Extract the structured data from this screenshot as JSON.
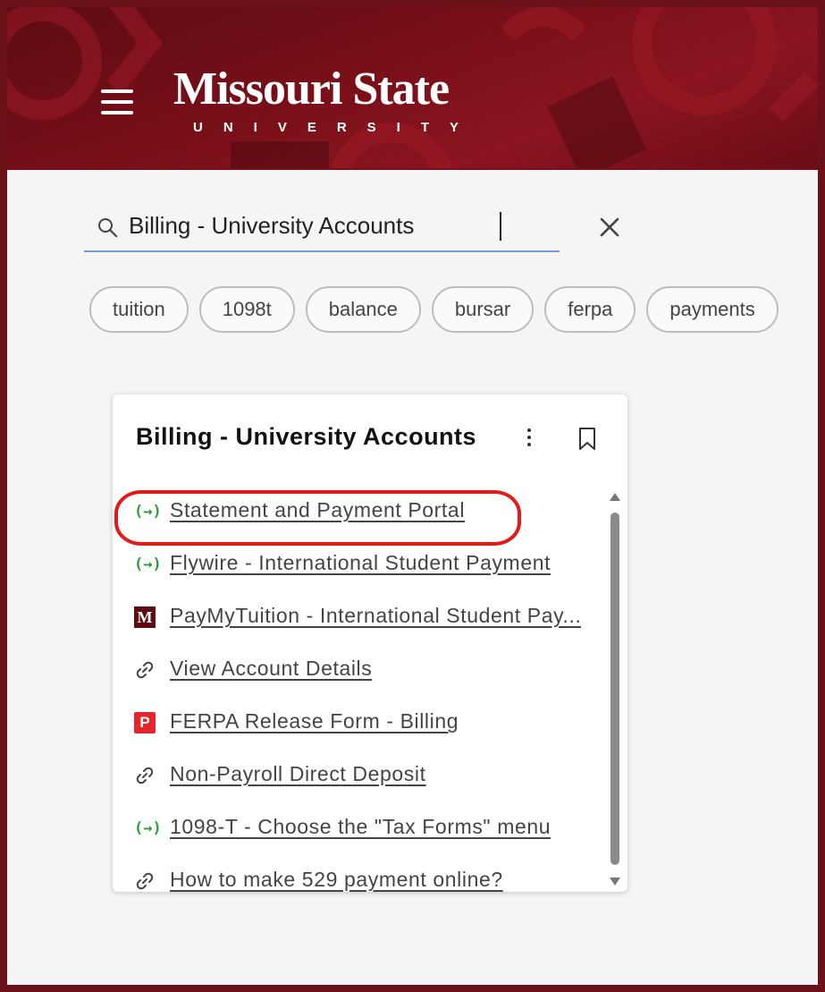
{
  "header": {
    "logo_main": "Missouri State",
    "logo_sub": "UNIVERSITY",
    "brand_color": "#7a1019"
  },
  "search": {
    "value": "Billing - University Accounts",
    "icon": "search-icon",
    "clear_icon": "close-icon"
  },
  "chips": [
    "tuition",
    "1098t",
    "balance",
    "bursar",
    "ferpa",
    "payments"
  ],
  "card": {
    "title": "Billing - University Accounts",
    "links": [
      {
        "label": "Statement and Payment Portal",
        "icon": "external-app-icon"
      },
      {
        "label": "Flywire - International Student Payment",
        "icon": "external-app-icon"
      },
      {
        "label": "PayMyTuition - International Student Pay...",
        "icon": "missouri-state-m-icon"
      },
      {
        "label": "View Account Details",
        "icon": "link-icon"
      },
      {
        "label": "FERPA Release Form - Billing",
        "icon": "pdf-icon"
      },
      {
        "label": "Non-Payroll Direct Deposit",
        "icon": "link-icon"
      },
      {
        "label": "1098-T - Choose the \"Tax Forms\" menu",
        "icon": "external-app-icon"
      },
      {
        "label": "How to make 529 payment online?",
        "icon": "link-icon"
      }
    ]
  },
  "highlight_color": "#e21a1a"
}
